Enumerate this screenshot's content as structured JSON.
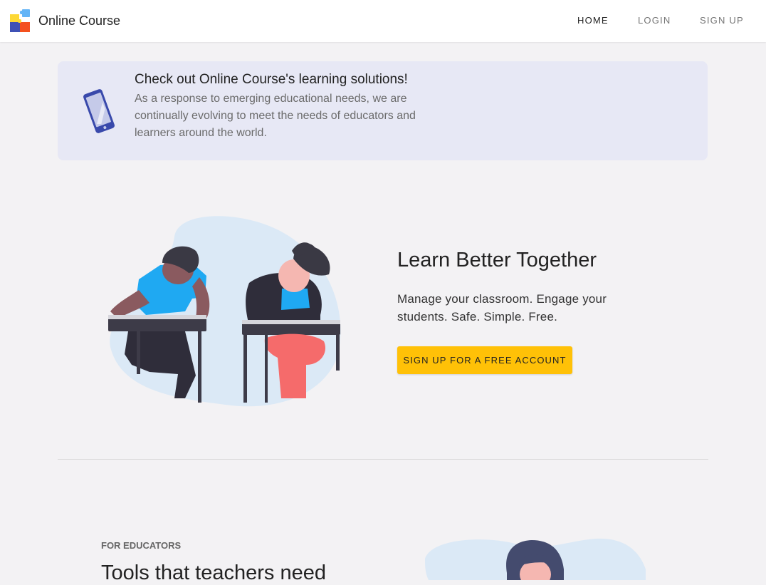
{
  "navbar": {
    "brand_name": "Online Course",
    "items": [
      {
        "label": "HOME",
        "active": true
      },
      {
        "label": "LOGIN",
        "active": false
      },
      {
        "label": "SIGN UP",
        "active": false
      }
    ]
  },
  "promo": {
    "title": "Check out Online Course's learning solutions!",
    "text": "As a response to emerging educational needs, we are continually evolving to meet the needs of educators and learners around the world."
  },
  "hero": {
    "title": "Learn Better Together",
    "text": "Manage your classroom. Engage your students. Safe. Simple. Free.",
    "cta_label": "SIGN UP FOR A FREE ACCOUNT"
  },
  "educators": {
    "eyebrow": "FOR EDUCATORS",
    "title": "Tools that teachers need"
  },
  "colors": {
    "accent": "#ffc107",
    "promo_bg": "#e7e8f5",
    "page_bg": "#f3f2f4",
    "illustration_blob": "#dbe9f6"
  },
  "icons": {
    "brand": "puzzle-logo-icon",
    "promo": "phone-icon"
  }
}
